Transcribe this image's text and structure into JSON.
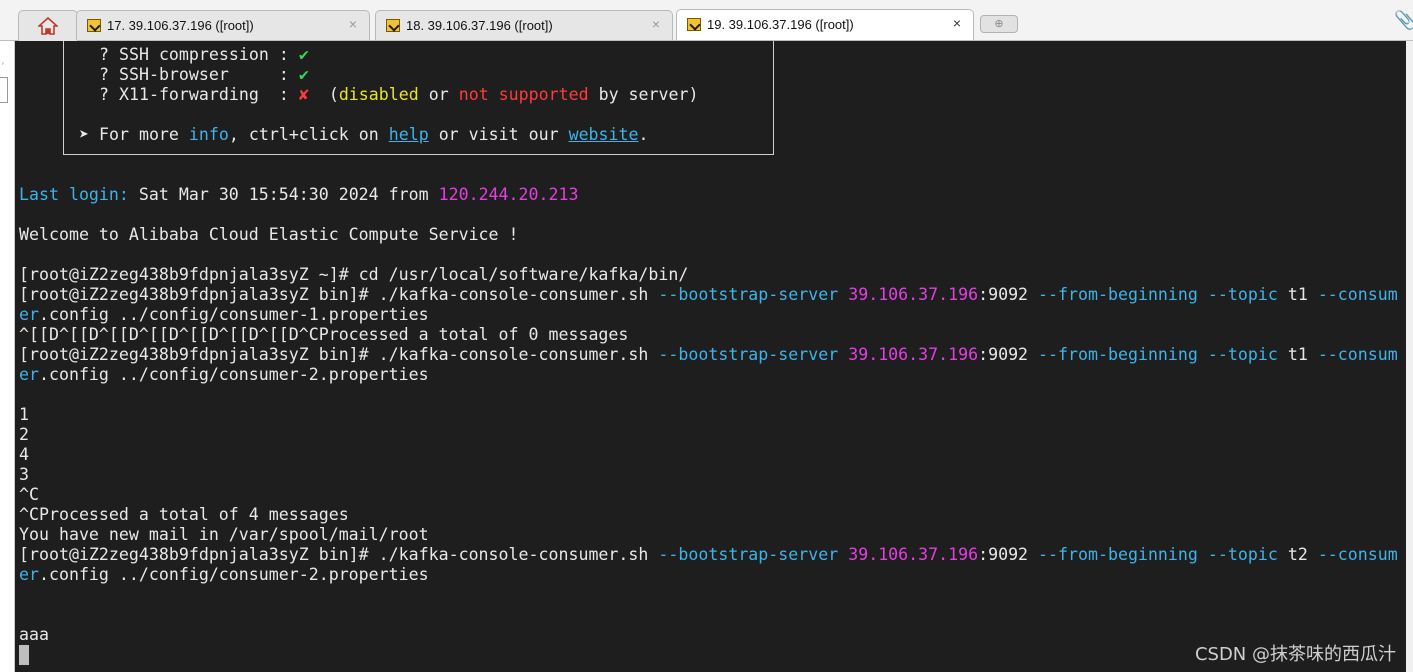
{
  "tabs": [
    {
      "label": "17. 39.106.37.196 ([root])",
      "active": false
    },
    {
      "label": "18. 39.106.37.196 ([root])",
      "active": false
    },
    {
      "label": "19. 39.106.37.196 ([root])",
      "active": true
    }
  ],
  "tab_close": "×",
  "new_tab": "⊕",
  "icons": {
    "home": "home-icon",
    "attach": "paperclip-icon",
    "session": "terminal-session-icon"
  },
  "terminal": {
    "features": [
      {
        "q": "? ",
        "name": "SSH compression :",
        "mark": "✔",
        "status": "ok"
      },
      {
        "q": "? ",
        "name": "SSH-browser     :",
        "mark": "✔",
        "status": "ok"
      },
      {
        "q": "? ",
        "name": "X11-forwarding  :",
        "mark": "✘",
        "status": "fail",
        "note_open": "(",
        "note_disabled": "disabled",
        "note_or": " or ",
        "note_not": "not supported",
        "note_by": " by server)"
      }
    ],
    "more_info": {
      "arrow": "➤",
      "t1": " For more ",
      "info": "info",
      "t2": ", ctrl+click on ",
      "help": "help",
      "t3": " or visit our ",
      "website": "website",
      "t4": "."
    },
    "last_login": {
      "label": "Last login:",
      "text": " Sat Mar 30 15:54:30 2024 from ",
      "ip": "120.244.20.213"
    },
    "welcome": "Welcome to Alibaba Cloud Elastic Compute Service !",
    "cmd_cd": "[root@iZ2zeg438b9fdpnjala3syZ ~]# cd /usr/local/software/kafka/bin/",
    "prompt_bin": "[root@iZ2zeg438b9fdpnjala3syZ bin]# ./kafka-console-consumer.sh ",
    "opt_bootstrap": "--bootstrap-server",
    "server_ip": "39.106.37.196",
    "server_port": ":9092 ",
    "opt_from": "--from-beginning",
    "opt_topic": "--topic",
    "opt_consum": "--consum",
    "cont_er": "er",
    "run1": {
      "topic": " t1 ",
      "config": ".config ../config/consumer-1.properties"
    },
    "ctrl_line": "^[[D^[[D^[[D^[[D^[[D^[[D^[[D^CProcessed a total of 0 messages",
    "run2": {
      "topic": " t1 ",
      "config": ".config ../config/consumer-2.properties"
    },
    "outputs": [
      "1",
      "2",
      "4",
      "3",
      "^C"
    ],
    "processed4": "^CProcessed a total of 4 messages",
    "mail": "You have new mail in /var/spool/mail/root",
    "run3": {
      "topic": " t2 ",
      "config": ".config ../config/consumer-2.properties"
    },
    "last_output": "aaa"
  },
  "watermark": "CSDN @抹茶味的西瓜汁"
}
